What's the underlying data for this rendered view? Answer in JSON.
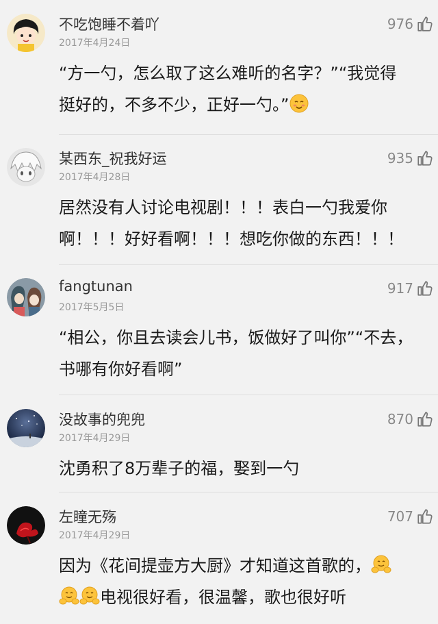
{
  "comments": [
    {
      "username": "不吃饱睡不着吖",
      "date": "2017年4月24日",
      "likes": "976",
      "avatar_icon": "girl-cartoon-avatar",
      "lines": [
        "“方一勺，怎么取了这么难听的名字？”“我觉得",
        "挺好的，不多不少，正好一勺。”"
      ]
    },
    {
      "username": "某西东_祝我好运",
      "date": "2017年4月28日",
      "likes": "935",
      "avatar_icon": "anime-sketch-avatar",
      "lines": [
        "居然没有人讨论电视剧！！！表白一勺我爱你",
        "啊！！！好好看啊！！！想吃你做的东西！！！"
      ]
    },
    {
      "username": "fangtunan",
      "date": "2017年5月5日",
      "likes": "917",
      "avatar_icon": "anime-couple-avatar",
      "lines": [
        "“相公，你且去读会儿书，饭做好了叫你”“不去，",
        "书哪有你好看啊”"
      ]
    },
    {
      "username": "没故事的兜兜",
      "date": "2017年4月29日",
      "likes": "870",
      "avatar_icon": "night-sky-avatar",
      "lines": [
        "沈勇积了8万辈子的福，娶到一勺"
      ]
    },
    {
      "username": "左瞳无殇",
      "date": "2017年4月29日",
      "likes": "707",
      "avatar_icon": "red-flower-avatar",
      "lines": [
        "因为《花间提壶方大厨》才知道这首歌的，",
        "电视很好看，很温馨，歌也很好听"
      ]
    }
  ],
  "icons": {
    "like": "thumbs-up-icon",
    "smile_emoji": "smiling-face-emoji",
    "hug_emoji": "hugging-face-emoji"
  }
}
